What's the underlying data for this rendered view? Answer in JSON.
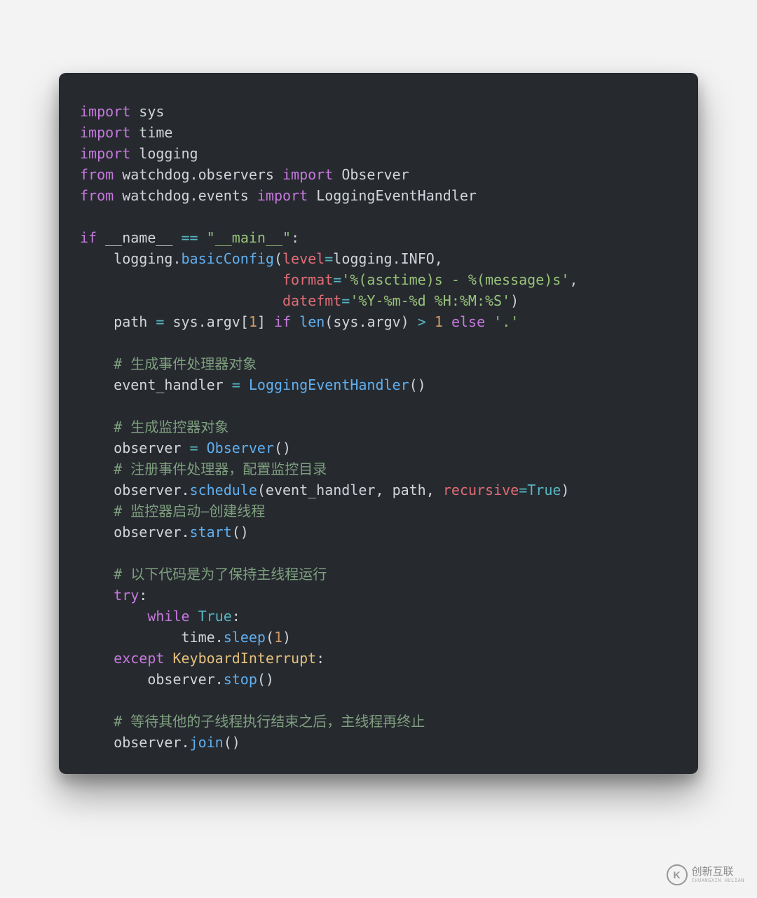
{
  "code": {
    "l01": {
      "kw": "import",
      "mod": "sys"
    },
    "l02": {
      "kw": "import",
      "mod": "time"
    },
    "l03": {
      "kw": "import",
      "mod": "logging"
    },
    "l04": {
      "kw1": "from",
      "pkg": "watchdog",
      "sub": "observers",
      "kw2": "import",
      "cls": "Observer"
    },
    "l05": {
      "kw1": "from",
      "pkg": "watchdog",
      "sub": "events",
      "kw2": "import",
      "cls": "LoggingEventHandler"
    },
    "l06": {
      "kw": "if",
      "dn": "__name__",
      "op": "==",
      "str": "\"__main__\""
    },
    "l07": {
      "obj": "logging",
      "fn": "basicConfig",
      "arg1": "level",
      "val1a": "logging",
      "val1b": "INFO"
    },
    "l08": {
      "arg": "format",
      "str": "'%(asctime)s - %(message)s'"
    },
    "l09": {
      "arg": "datefmt",
      "str": "'%Y-%m-%d %H:%M:%S'"
    },
    "l10": {
      "var": "path",
      "obj": "sys",
      "attr": "argv",
      "idx": "1",
      "kwif": "if",
      "fn": "len",
      "obj2": "sys",
      "attr2": "argv",
      "op": ">",
      "num": "1",
      "kwelse": "else",
      "str": "'.'"
    },
    "c1": "# 生成事件处理器对象",
    "l11": {
      "var": "event_handler",
      "cls": "LoggingEventHandler"
    },
    "c2": "# 生成监控器对象",
    "l12": {
      "var": "observer",
      "cls": "Observer"
    },
    "c3": "# 注册事件处理器，配置监控目录",
    "l13": {
      "obj": "observer",
      "fn": "schedule",
      "a1": "event_handler",
      "a2": "path",
      "kwarg": "recursive",
      "bool": "True"
    },
    "c4": "# 监控器启动—创建线程",
    "l14": {
      "obj": "observer",
      "fn": "start"
    },
    "c5": "# 以下代码是为了保持主线程运行",
    "l15": {
      "kw": "try"
    },
    "l16": {
      "kw": "while",
      "bool": "True"
    },
    "l17": {
      "obj": "time",
      "fn": "sleep",
      "num": "1"
    },
    "l18": {
      "kw": "except",
      "cls": "KeyboardInterrupt"
    },
    "l19": {
      "obj": "observer",
      "fn": "stop"
    },
    "c6": "# 等待其他的子线程执行结束之后，主线程再终止",
    "l20": {
      "obj": "observer",
      "fn": "join"
    }
  },
  "watermark": {
    "glyph": "K",
    "name": "创新互联",
    "sub": "CHUANGXIN HULIAN"
  }
}
